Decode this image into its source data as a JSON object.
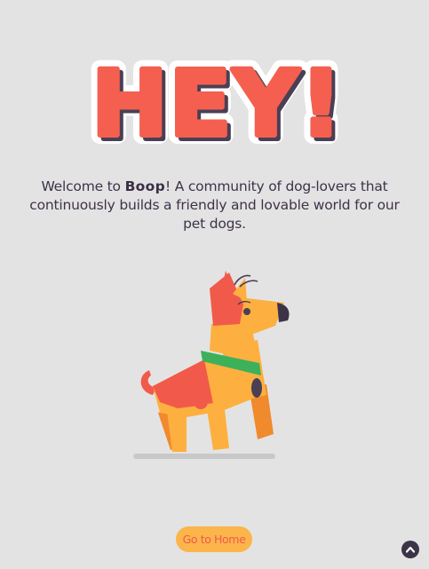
{
  "hero": {
    "title": "HEY!"
  },
  "intro": {
    "prefix": "Welcome to ",
    "brand": "Boop",
    "suffix": "! A community of dog-lovers that continuously builds a friendly and lovable world for our pet dogs."
  },
  "actions": {
    "go_home_label": "Go to Home"
  },
  "icons": {
    "scroll_top": "chevron-up-circle-icon",
    "illustration": "dog-illustration"
  },
  "colors": {
    "background": "#e4e3e4",
    "title_red": "#f45f50",
    "text_dark": "#3d3348",
    "button_orange": "#fbb54a",
    "button_text": "#f05a4e",
    "dog_orange": "#fdb03f",
    "dog_red": "#f15a4a",
    "collar_green": "#3cb15a"
  }
}
